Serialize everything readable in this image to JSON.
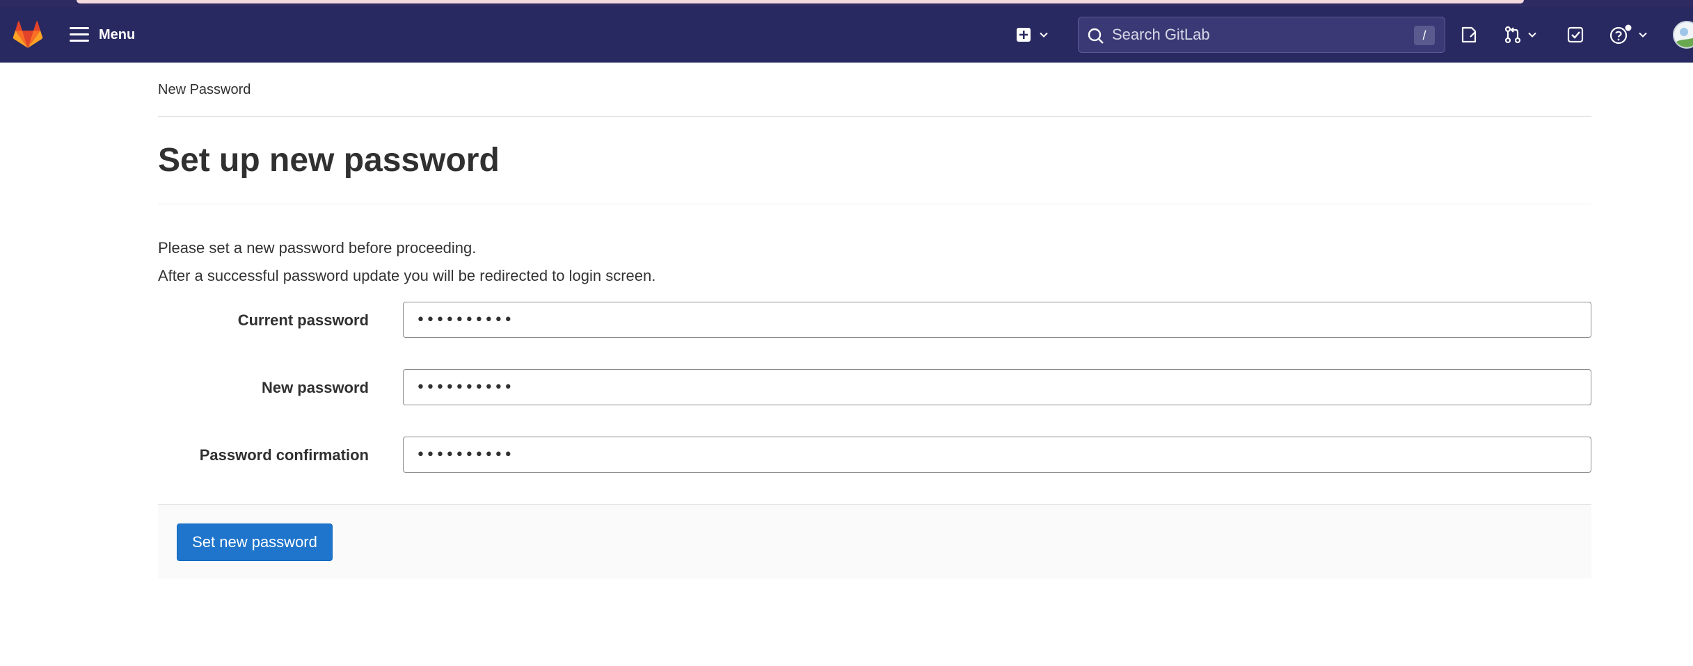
{
  "navbar": {
    "menu_label": "Menu",
    "search": {
      "placeholder": "Search GitLab",
      "shortcut": "/"
    },
    "colors": {
      "background": "#292961",
      "logo_orange": "#e24329"
    },
    "icons": [
      "gitlab-logo-icon",
      "hamburger-icon",
      "plus-square-icon",
      "chevron-down-icon",
      "search-icon",
      "issues-icon",
      "merge-request-icon",
      "todo-icon",
      "help-icon",
      "avatar"
    ]
  },
  "breadcrumb": {
    "current": "New Password"
  },
  "page": {
    "title": "Set up new password",
    "intro_line1": "Please set a new password before proceeding.",
    "intro_line2": "After a successful password update you will be redirected to login screen."
  },
  "form": {
    "current_password": {
      "label": "Current password",
      "value": "••••••••••"
    },
    "new_password": {
      "label": "New password",
      "value": "••••••••••"
    },
    "password_confirmation": {
      "label": "Password confirmation",
      "value": "••••••••••"
    },
    "submit_label": "Set new password",
    "colors": {
      "submit_button": "#1f75cb"
    }
  }
}
